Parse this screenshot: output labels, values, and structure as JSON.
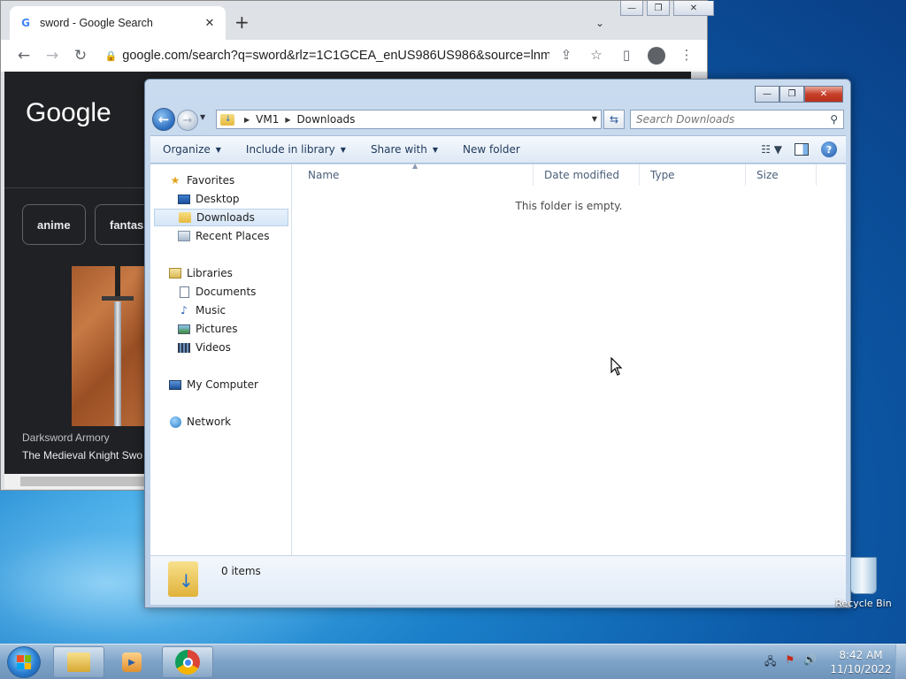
{
  "chrome": {
    "tab_title": "sword - Google Search",
    "favicon_letter": "G",
    "tab_close": "✕",
    "new_tab": "+",
    "tab_search": "⌄",
    "url": "google.com/search?q=sword&rlz=1C1GCEA_enUS986US986&source=lnm...",
    "nav": {
      "back": "←",
      "forward": "→",
      "reload": "↻"
    },
    "window_buttons": {
      "minimize": "—",
      "restore": "❐",
      "close": "✕"
    },
    "content": {
      "logo": "Google",
      "chips": [
        "anime",
        "fantas"
      ],
      "result_source": "Darksword Armory",
      "result_title": "The Medieval Knight Swo"
    }
  },
  "explorer": {
    "caption": {
      "minimize": "—",
      "restore": "❐",
      "close": "✕"
    },
    "address": {
      "crumbs": [
        "VM1",
        "Downloads"
      ]
    },
    "search": {
      "placeholder": "Search Downloads"
    },
    "commands": [
      {
        "label": "Organize",
        "has_dropdown": true
      },
      {
        "label": "Include in library",
        "has_dropdown": true
      },
      {
        "label": "Share with",
        "has_dropdown": true
      },
      {
        "label": "New folder",
        "has_dropdown": false
      }
    ],
    "nav_pane": {
      "favorites": {
        "label": "Favorites",
        "items": [
          "Desktop",
          "Downloads",
          "Recent Places"
        ]
      },
      "libraries": {
        "label": "Libraries",
        "items": [
          "Documents",
          "Music",
          "Pictures",
          "Videos"
        ]
      },
      "computer": "My Computer",
      "network": "Network"
    },
    "columns": [
      "Name",
      "Date modified",
      "Type",
      "Size"
    ],
    "empty_message": "This folder is empty.",
    "item_count": "0 items"
  },
  "desktop": {
    "recycle_bin": "Recycle Bin"
  },
  "taskbar": {
    "time": "8:42 AM",
    "date": "11/10/2022"
  },
  "colors": {
    "accent": "#1f58a8",
    "selection": "#d6e6f7",
    "chrome_dark": "#202124"
  }
}
